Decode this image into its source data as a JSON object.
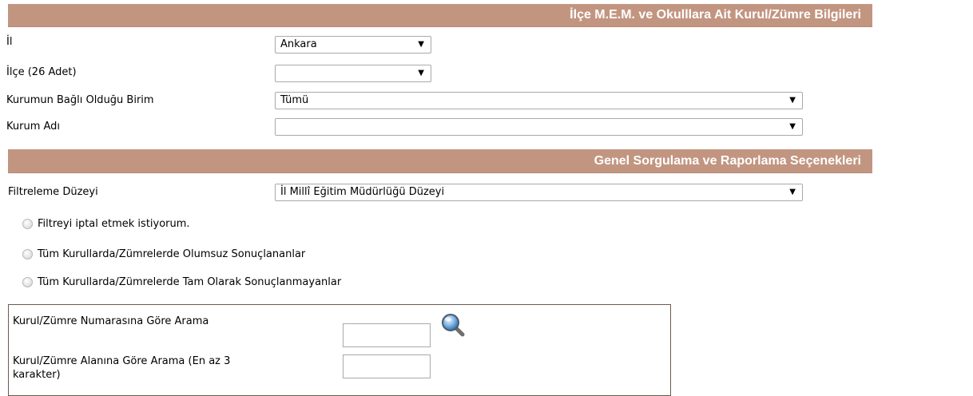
{
  "section1": {
    "title": "İlçe M.E.M. ve Okulllara Ait Kurul/Zümre Bilgileri",
    "il_label": "İl",
    "il_value": "Ankara",
    "ilce_label": "İlçe (26 Adet)",
    "ilce_value": "",
    "birim_label": "Kurumun Bağlı Olduğu Birim",
    "birim_value": "Tümü",
    "kurum_label": "Kurum Adı",
    "kurum_value": ""
  },
  "section2": {
    "title": "Genel Sorgulama ve Raporlama Seçenekleri",
    "filter_label": "Filtreleme Düzeyi",
    "filter_value": "İl Millî Eğitim Müdürlüğü Düzeyi",
    "radio_options": [
      "Filtreyi iptal etmek istiyorum.",
      "Tüm Kurullarda/Zümrelerde Olumsuz Sonuçlananlar",
      "Tüm Kurullarda/Zümrelerde Tam Olarak Sonuçlanmayanlar"
    ]
  },
  "search": {
    "number_label": "Kurul/Zümre Numarasına Göre Arama",
    "number_value": "",
    "area_label_line1": "Kurul/Zümre Alanına Göre Arama (En az 3",
    "area_label_line2": "karakter)",
    "area_value": ""
  },
  "colors": {
    "header_bg": "#c29580",
    "header_text": "#ffffff"
  },
  "icons": {
    "search": "magnifier-icon",
    "dropdown": "triangle-down"
  }
}
